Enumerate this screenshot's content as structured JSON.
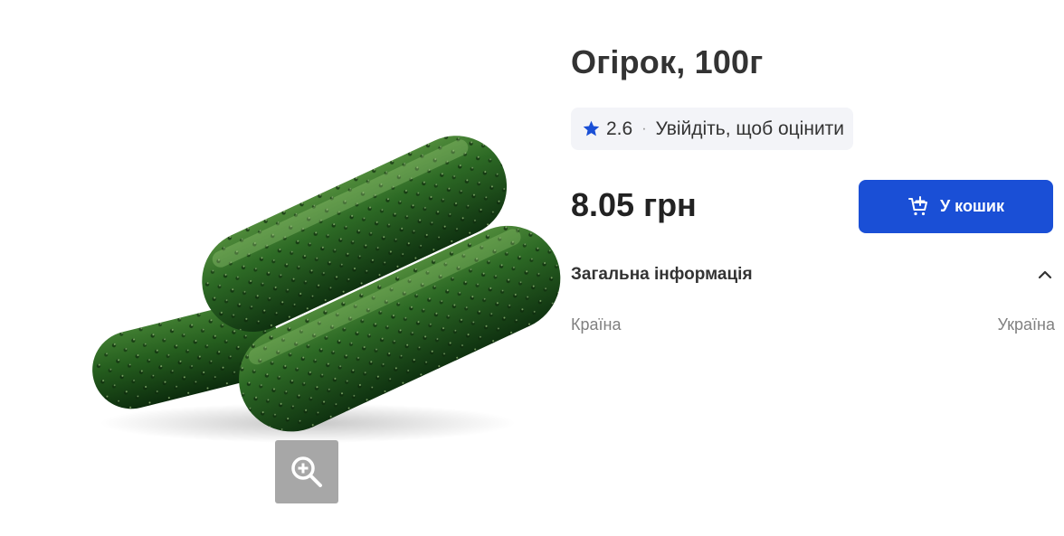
{
  "product": {
    "title": "Огірок, 100г",
    "image_alt": "cucumbers",
    "price": "8.05 грн"
  },
  "rating": {
    "value": "2.6",
    "separator": "·",
    "login_text": "Увійдіть, щоб оцінити",
    "star_color": "#1a4fd6"
  },
  "cart_button": {
    "label": "У кошик",
    "icon": "cart-plus-icon",
    "color": "#1a4fd6"
  },
  "info_section": {
    "title": "Загальна інформація",
    "icon": "chevron-up-icon",
    "rows": [
      {
        "label": "Країна",
        "value": "Україна"
      }
    ]
  },
  "zoom": {
    "icon": "zoom-in-icon"
  }
}
